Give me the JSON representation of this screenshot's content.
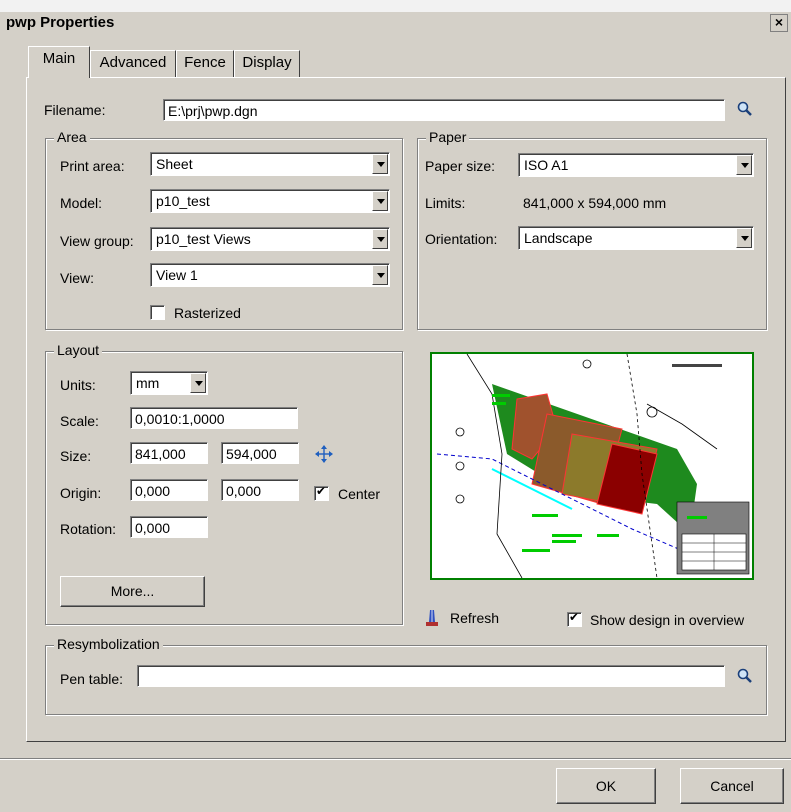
{
  "window": {
    "title": "pwp Properties",
    "close_glyph": "×"
  },
  "tabs": [
    {
      "label": "Main",
      "active": true
    },
    {
      "label": "Advanced",
      "active": false
    },
    {
      "label": "Fence",
      "active": false
    },
    {
      "label": "Display",
      "active": false
    }
  ],
  "filename": {
    "label": "Filename:",
    "value": "E:\\prj\\pwp.dgn"
  },
  "area": {
    "legend": "Area",
    "print_area": {
      "label": "Print area:",
      "value": "Sheet"
    },
    "model": {
      "label": "Model:",
      "value": "p10_test"
    },
    "view_group": {
      "label": "View group:",
      "value": "p10_test Views"
    },
    "view": {
      "label": "View:",
      "value": "View 1"
    },
    "rasterized": {
      "label": "Rasterized",
      "checked": false
    }
  },
  "paper": {
    "legend": "Paper",
    "paper_size": {
      "label": "Paper size:",
      "value": "ISO A1"
    },
    "limits": {
      "label": "Limits:",
      "value": "841,000 x 594,000 mm"
    },
    "orientation": {
      "label": "Orientation:",
      "value": "Landscape"
    }
  },
  "layout": {
    "legend": "Layout",
    "units": {
      "label": "Units:",
      "value": "mm"
    },
    "scale": {
      "label": "Scale:",
      "value": "0,0010:1,0000"
    },
    "size": {
      "label": "Size:",
      "width": "841,000",
      "height": "594,000"
    },
    "origin": {
      "label": "Origin:",
      "x": "0,000",
      "y": "0,000"
    },
    "center": {
      "label": "Center",
      "checked": true
    },
    "rotation": {
      "label": "Rotation:",
      "value": "0,000"
    },
    "more_button": "More..."
  },
  "preview": {
    "refresh_label": "Refresh",
    "show_design": {
      "label": "Show design in overview",
      "checked": true
    }
  },
  "resymbolization": {
    "legend": "Resymbolization",
    "pen_table": {
      "label": "Pen table:",
      "value": ""
    }
  },
  "footer": {
    "ok": "OK",
    "cancel": "Cancel"
  },
  "colors": {
    "dialog_bg": "#d4d0c8",
    "preview_border": "#008000"
  },
  "icons": [
    "magnifier-icon",
    "move-arrows-icon",
    "refresh-pen-icon",
    "close-icon"
  ]
}
